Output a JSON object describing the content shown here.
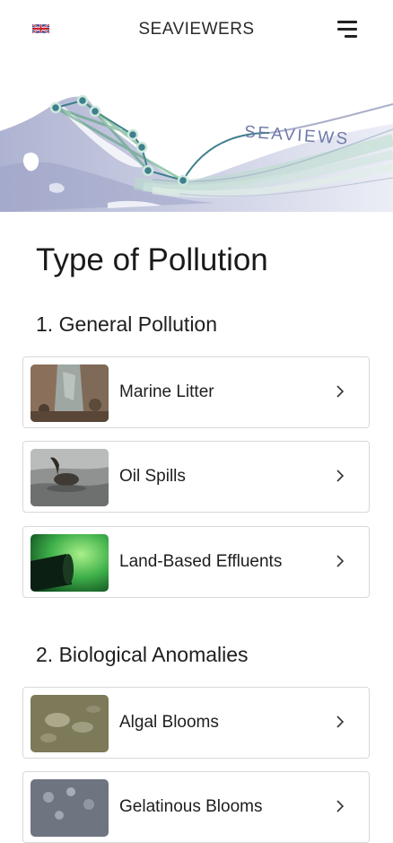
{
  "header": {
    "title": "SEAVIEWERS",
    "language_icon": "uk-flag-icon",
    "menu_icon": "hamburger-menu-icon"
  },
  "banner": {
    "logo_text": "SEAVIEWS"
  },
  "page": {
    "title": "Type of Pollution"
  },
  "sections": [
    {
      "title": "1. General Pollution",
      "items": [
        {
          "label": "Marine Litter"
        },
        {
          "label": "Oil Spills"
        },
        {
          "label": "Land-Based Effluents"
        }
      ]
    },
    {
      "title": "2. Biological Anomalies",
      "items": [
        {
          "label": "Algal Blooms"
        },
        {
          "label": "Gelatinous Blooms"
        }
      ]
    }
  ],
  "colors": {
    "accent_green": "#4f9e73",
    "route_teal": "#3d7f8c",
    "map_land": "#c9cde3",
    "border": "#d9d9d9"
  }
}
